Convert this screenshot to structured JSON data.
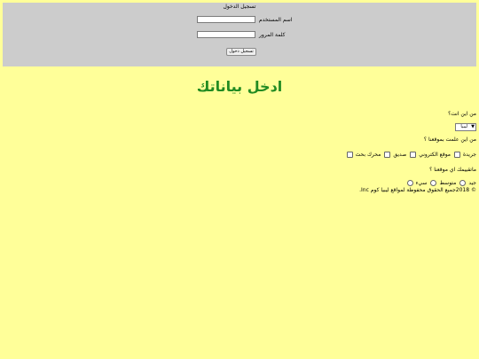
{
  "login": {
    "title": "تسجيل الدخول",
    "username_label": "اسم المستخدم",
    "password_label": "كلمة المرور",
    "submit_label": "تسجيل دخول"
  },
  "heading": "ادخل بياناتك",
  "q1": {
    "label": "من اين انت؟",
    "selected": "ليبيا"
  },
  "q2": {
    "label": "من اين علمت بموقعنا ؟",
    "options": [
      "جريدة",
      "موقع الكتروني",
      "صديق",
      "محرك بحث"
    ]
  },
  "q3": {
    "label": "ماتقييمك اي موقعنا ؟",
    "options": [
      "جيد",
      "متوسط",
      "سيء"
    ]
  },
  "footer": "© 2018جميع الحقوق محفوظة لمواقع ليبيا كوم Inc."
}
